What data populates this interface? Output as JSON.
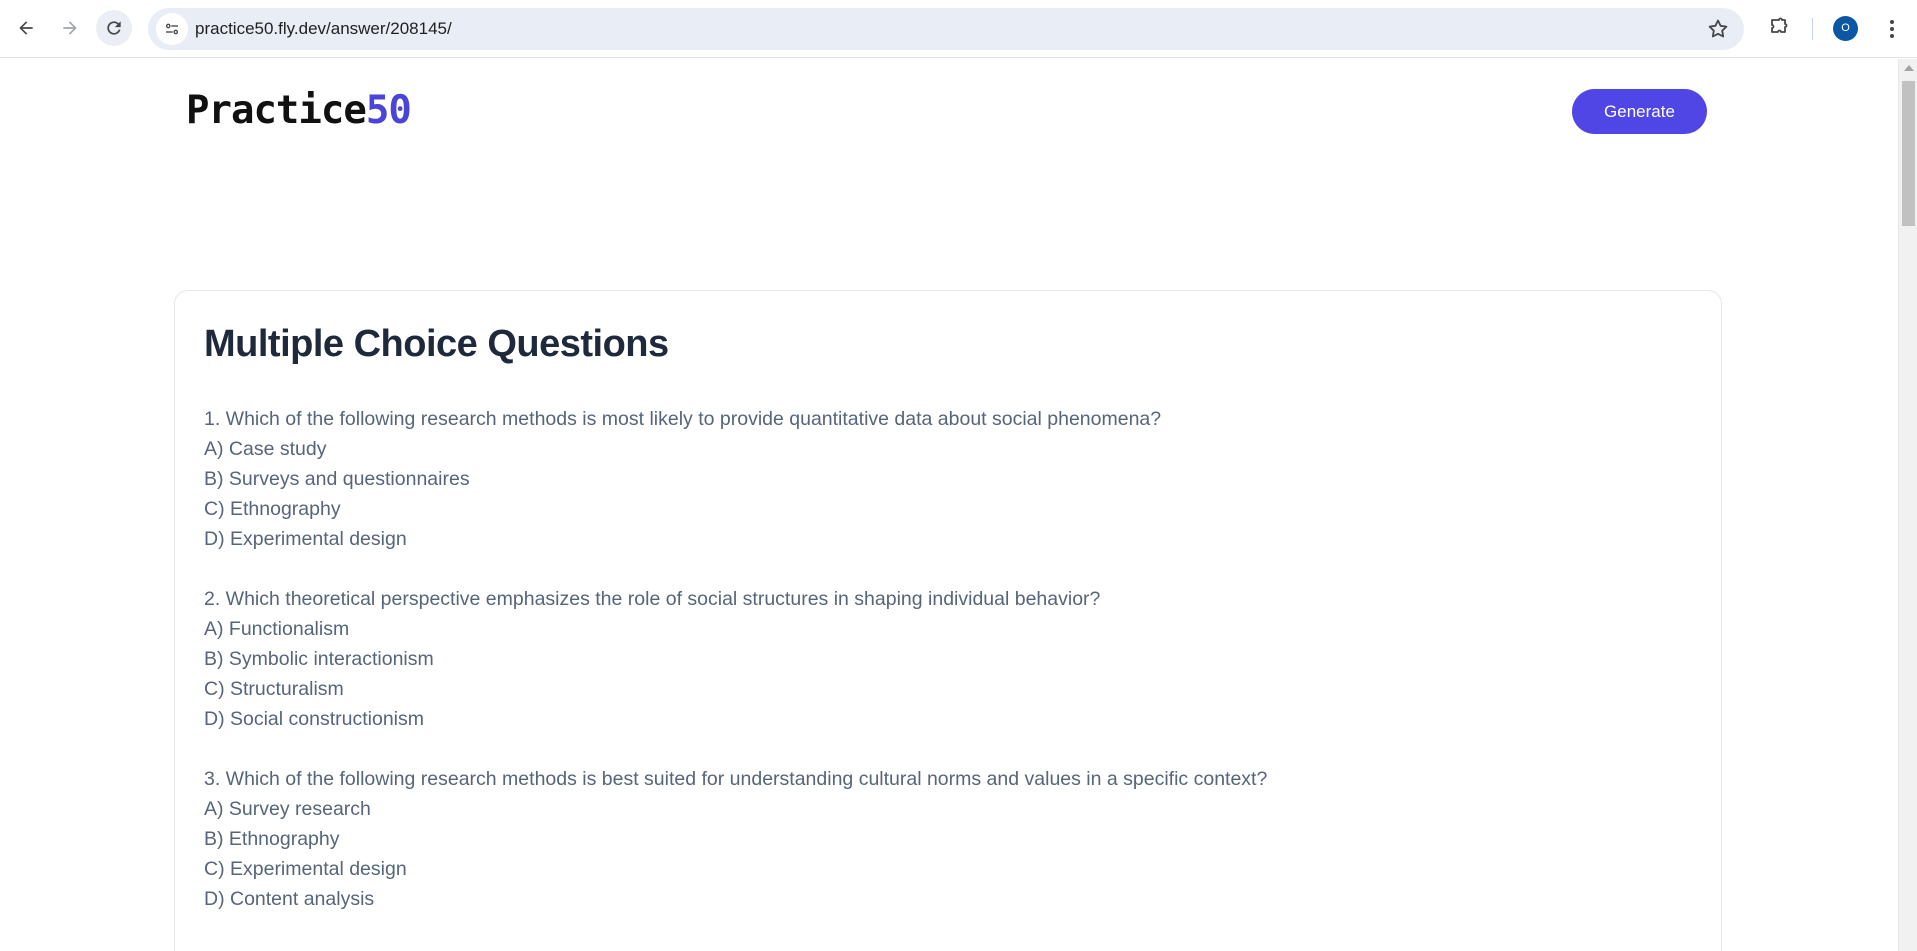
{
  "browser": {
    "url": "practice50.fly.dev/answer/208145/",
    "profile_initial": "O",
    "icons": [
      "back-icon",
      "forward-icon",
      "reload-icon",
      "site-info-icon",
      "bookmark-star-icon",
      "extensions-icon",
      "kebab-menu-icon"
    ]
  },
  "header": {
    "logo_text": "Practice",
    "logo_accent": "50",
    "generate_label": "Generate"
  },
  "main": {
    "title": "Multiple Choice Questions",
    "questions": [
      {
        "text": "1. Which of the following research methods is most likely to provide quantitative data about social phenomena?",
        "options": [
          "A) Case study",
          "B) Surveys and questionnaires",
          "C) Ethnography",
          "D) Experimental design"
        ]
      },
      {
        "text": "2. Which theoretical perspective emphasizes the role of social structures in shaping individual behavior?",
        "options": [
          "A) Functionalism",
          "B) Symbolic interactionism",
          "C) Structuralism",
          "D) Social constructionism"
        ]
      },
      {
        "text": "3. Which of the following research methods is best suited for understanding cultural norms and values in a specific context?",
        "options": [
          "A) Survey research",
          "B) Ethnography",
          "C) Experimental design",
          "D) Content analysis"
        ]
      }
    ]
  },
  "colors": {
    "brand_accent": "#4f46e5",
    "title_text": "#1e293b",
    "body_text": "#56657a"
  }
}
